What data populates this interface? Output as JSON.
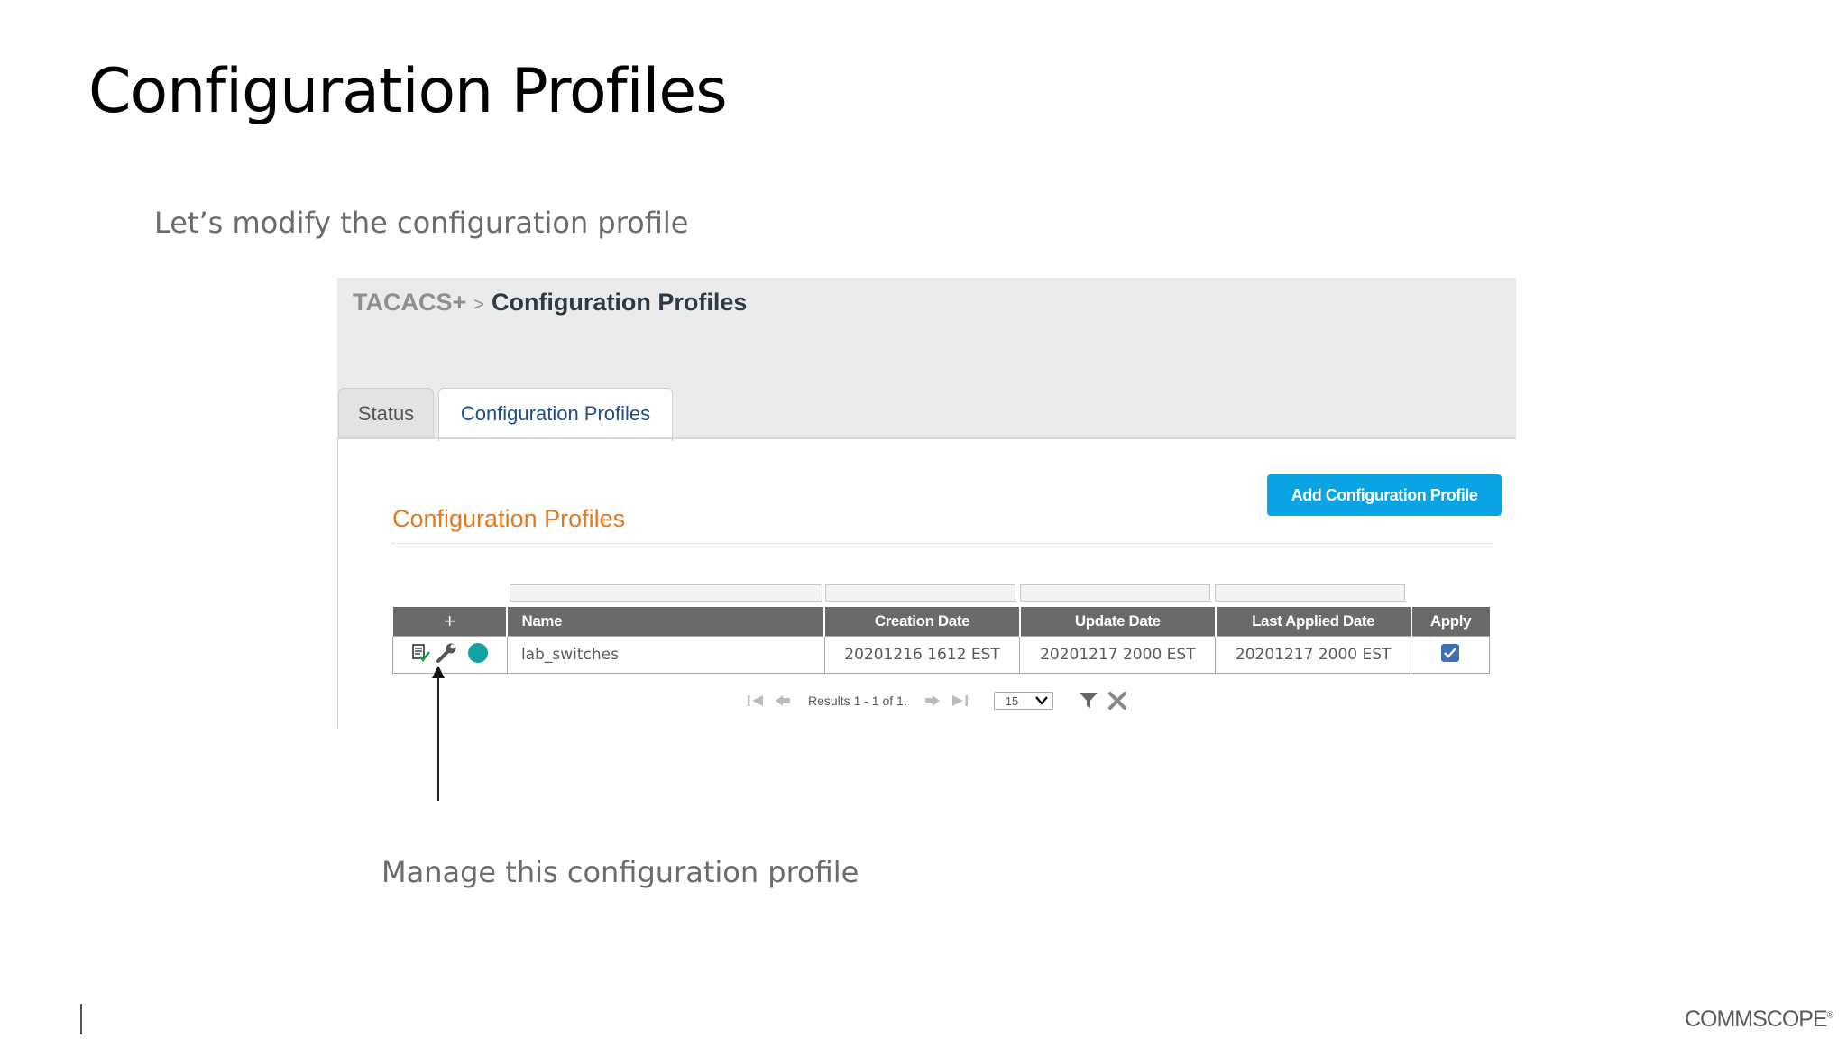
{
  "slide": {
    "title": "Configuration Profiles",
    "subtitle": "Let’s modify the configuration profile",
    "caption": "Manage this configuration profile",
    "brand": "COMMSCOPE",
    "brand_mark": "®"
  },
  "app": {
    "breadcrumb": {
      "root": "TACACS+",
      "separator": ">",
      "current": "Configuration Profiles"
    },
    "tabs": [
      {
        "label": "Status",
        "active": false
      },
      {
        "label": "Configuration Profiles",
        "active": true
      }
    ],
    "add_button_label": "Add Configuration Profile",
    "section_title": "Configuration Profiles",
    "table": {
      "columns": [
        "+",
        "Name",
        "Creation Date",
        "Update Date",
        "Last Applied Date",
        "Apply"
      ],
      "rows": [
        {
          "name": "lab_switches",
          "creation_date": "20201216 1612 EST",
          "update_date": "20201217 2000 EST",
          "last_applied_date": "20201217 2000 EST",
          "apply": true,
          "actions": [
            "edit-icon",
            "wrench-icon",
            "status-dot-icon"
          ]
        }
      ]
    },
    "pager": {
      "results_text": "Results 1 - 1 of 1.",
      "page_size": "15"
    },
    "colors": {
      "accent_blue": "#0aa3e3",
      "section_orange": "#e07b22",
      "header_gray": "#6a6a6a",
      "status_teal": "#14a3a3",
      "checkbox_blue": "#3b6fb6"
    }
  }
}
